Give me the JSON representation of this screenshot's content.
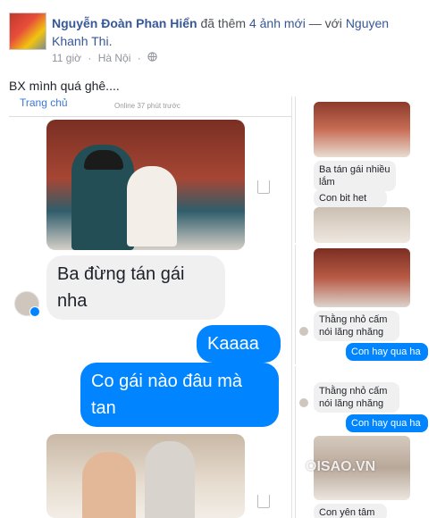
{
  "post": {
    "author": "Nguyễn Đoàn Phan Hiển",
    "action": " đã thêm ",
    "photos_link": "4 ảnh mới",
    "with_text": " — với ",
    "tagged": "Nguyen Khanh Thi",
    "period": ".",
    "time": "11 giờ",
    "separator": "·",
    "location": "Hà Nội",
    "separator2": "·",
    "privacy_icon": "globe-icon",
    "caption": "BX mình quá ghê...."
  },
  "left_shot": {
    "back_label": "Trang chủ",
    "online_label": "Online 37 phút trước",
    "messages": [
      {
        "type": "in",
        "text": "Ba đừng tán gái nha"
      },
      {
        "type": "out",
        "text": "Kaaaa"
      },
      {
        "type": "out",
        "text": "Co gái nào đâu mà tan"
      }
    ]
  },
  "right_shots": {
    "panel1": {
      "messages": [
        {
          "type": "in",
          "text": "Ba tán gái nhiều lắm"
        },
        {
          "type": "in",
          "text": "Con bit het"
        }
      ]
    },
    "panel2": {
      "messages": [
        {
          "type": "in",
          "text": "Thằng nhỏ cấm nói lăng nhăng"
        },
        {
          "type": "out",
          "text": "Con hay qua ha"
        }
      ]
    },
    "panel3": {
      "messages": [
        {
          "type": "in",
          "text": "Thằng nhỏ cấm nói lăng nhăng"
        },
        {
          "type": "out",
          "text": "Con hay qua ha"
        },
        {
          "type": "in",
          "text": "Con yên tâm"
        }
      ]
    }
  },
  "watermark": "OISAO.VN",
  "colors": {
    "link": "#365899",
    "messenger_blue": "#0084ff",
    "bubble_gray": "#f1f0f0"
  }
}
